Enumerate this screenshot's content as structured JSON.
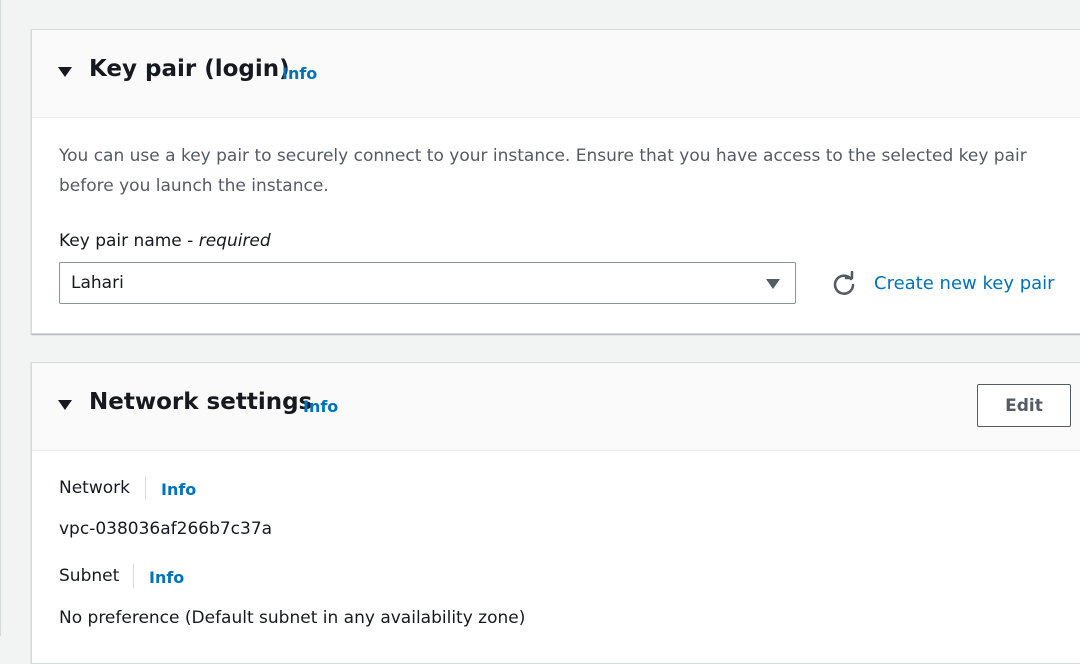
{
  "key_pair_panel": {
    "title": "Key pair (login)",
    "info_label": "Info",
    "description": "You can use a key pair to securely connect to your instance. Ensure that you have access to the selected key pair before you launch the instance.",
    "field_label": "Key pair name - ",
    "field_required": "required",
    "selected_value": "Lahari",
    "create_link": "Create new key pair",
    "icons": {
      "expand": "caret-down-icon",
      "select": "caret-down-icon",
      "refresh": "refresh-icon"
    }
  },
  "network_panel": {
    "title": "Network settings",
    "info_label": "Info",
    "edit_label": "Edit",
    "network": {
      "label": "Network",
      "info_label": "Info",
      "value": "vpc-038036af266b7c37a"
    },
    "subnet": {
      "label": "Subnet",
      "info_label": "Info",
      "value": "No preference (Default subnet in any availability zone)"
    }
  },
  "colors": {
    "link": "#0073bb",
    "text": "#16191f",
    "muted_text": "#545b64",
    "border": "#d5dbdb",
    "header_bg": "#fafafa"
  }
}
